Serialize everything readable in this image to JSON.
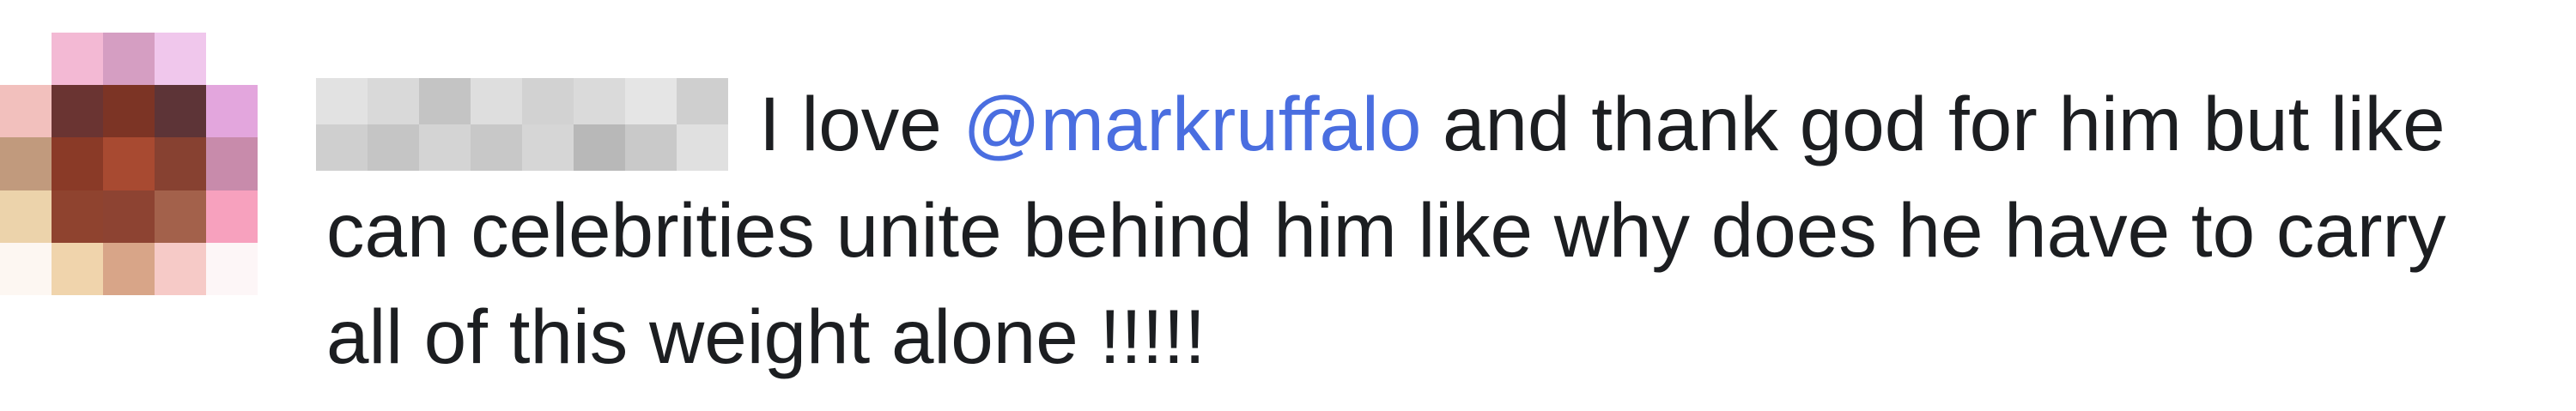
{
  "comment": {
    "text_before_mention": "I love ",
    "mention": "@markruffalo",
    "text_after_mention": " and thank god for him but like can celebrities unite behind him like why does he have to carry all of this weight alone !!!!!",
    "colors": {
      "text": "#1c1e21",
      "mention": "#4a6ee0"
    }
  },
  "avatar": {
    "icon": "pixelated-avatar-icon",
    "colors": [
      [
        "#ffffff",
        "#f3b9d4",
        "#d59ec2",
        "#f0c7ec",
        "#ffffff"
      ],
      [
        "#f2c0bd",
        "#6a3432",
        "#7c3425",
        "#5d3437",
        "#e3a6dd"
      ],
      [
        "#c19a7d",
        "#8a3a27",
        "#a84a31",
        "#874131",
        "#c88bab"
      ],
      [
        "#ecd3ab",
        "#8f432f",
        "#8d4332",
        "#a3614b",
        "#f7a1be"
      ],
      [
        "#fdf7f2",
        "#f0d4ac",
        "#d8a588",
        "#f6cac7",
        "#fdf6f7"
      ]
    ]
  },
  "username_blur": {
    "colors": [
      [
        "#e2e2e2",
        "#d9d9d9",
        "#c4c4c4",
        "#dedede",
        "#d2d2d2",
        "#dadada",
        "#e5e5e5",
        "#cfcfcf"
      ],
      [
        "#cfcfcf",
        "#c5c5c5",
        "#d4d4d4",
        "#c8c8c8",
        "#d6d6d6",
        "#b8b8b8",
        "#c9c9c9",
        "#e0e0e0"
      ]
    ]
  }
}
